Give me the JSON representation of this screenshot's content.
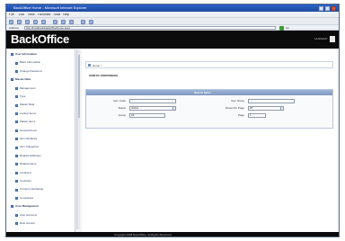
{
  "window": {
    "title": "BackOffice Home - Microsoft Internet Explorer"
  },
  "browser": {
    "menu": [
      "File",
      "Edit",
      "View",
      "Favorites",
      "Tools",
      "Help"
    ],
    "address_label": "Address",
    "url": "http://localhost/backoffice/home.aspx",
    "go_label": "Go"
  },
  "app": {
    "logo": "BackOffice",
    "logout_label": "LOGOUT"
  },
  "sidebar": {
    "items": [
      {
        "label": "User Information",
        "head": true
      },
      {
        "label": "Basic Information",
        "head": false
      },
      {
        "label": "Change Password",
        "head": false
      },
      {
        "label": "Master Data",
        "head": true
      },
      {
        "label": "Management",
        "head": false
      },
      {
        "label": "Type",
        "head": false
      },
      {
        "label": "Master Data",
        "head": false
      },
      {
        "label": "Lookup Items",
        "head": false
      },
      {
        "label": "Master Items",
        "head": false
      },
      {
        "label": "General Items",
        "head": false
      },
      {
        "label": "Item Attributes",
        "head": false
      },
      {
        "label": "Item Categories",
        "head": false
      },
      {
        "label": "Related Attributes",
        "head": false
      },
      {
        "label": "Related Items",
        "head": false
      },
      {
        "label": "Locations",
        "head": false
      },
      {
        "label": "Countries",
        "head": false
      },
      {
        "label": "Currency Exchange",
        "head": false
      },
      {
        "label": "Companies",
        "head": false
      },
      {
        "label": "User Management",
        "head": true
      },
      {
        "label": "User Accounts",
        "head": false
      },
      {
        "label": "Role Groups",
        "head": false
      }
    ]
  },
  "main": {
    "breadcrumb": "Home >",
    "section_title": "Search Information",
    "panel": {
      "title": "Search Items",
      "fields": {
        "code_label": "Item Code",
        "name_label": "Item Name",
        "page_label": "Page",
        "page_value": "1",
        "rows_label": "Rows Per Page",
        "rows_value": "20",
        "status_label": "Status",
        "status_value": "Active",
        "group_label": "Group",
        "group_value": "All"
      }
    }
  },
  "footer": {
    "text": "Copyright 2008 BackOffice. All Rights Reserved."
  }
}
